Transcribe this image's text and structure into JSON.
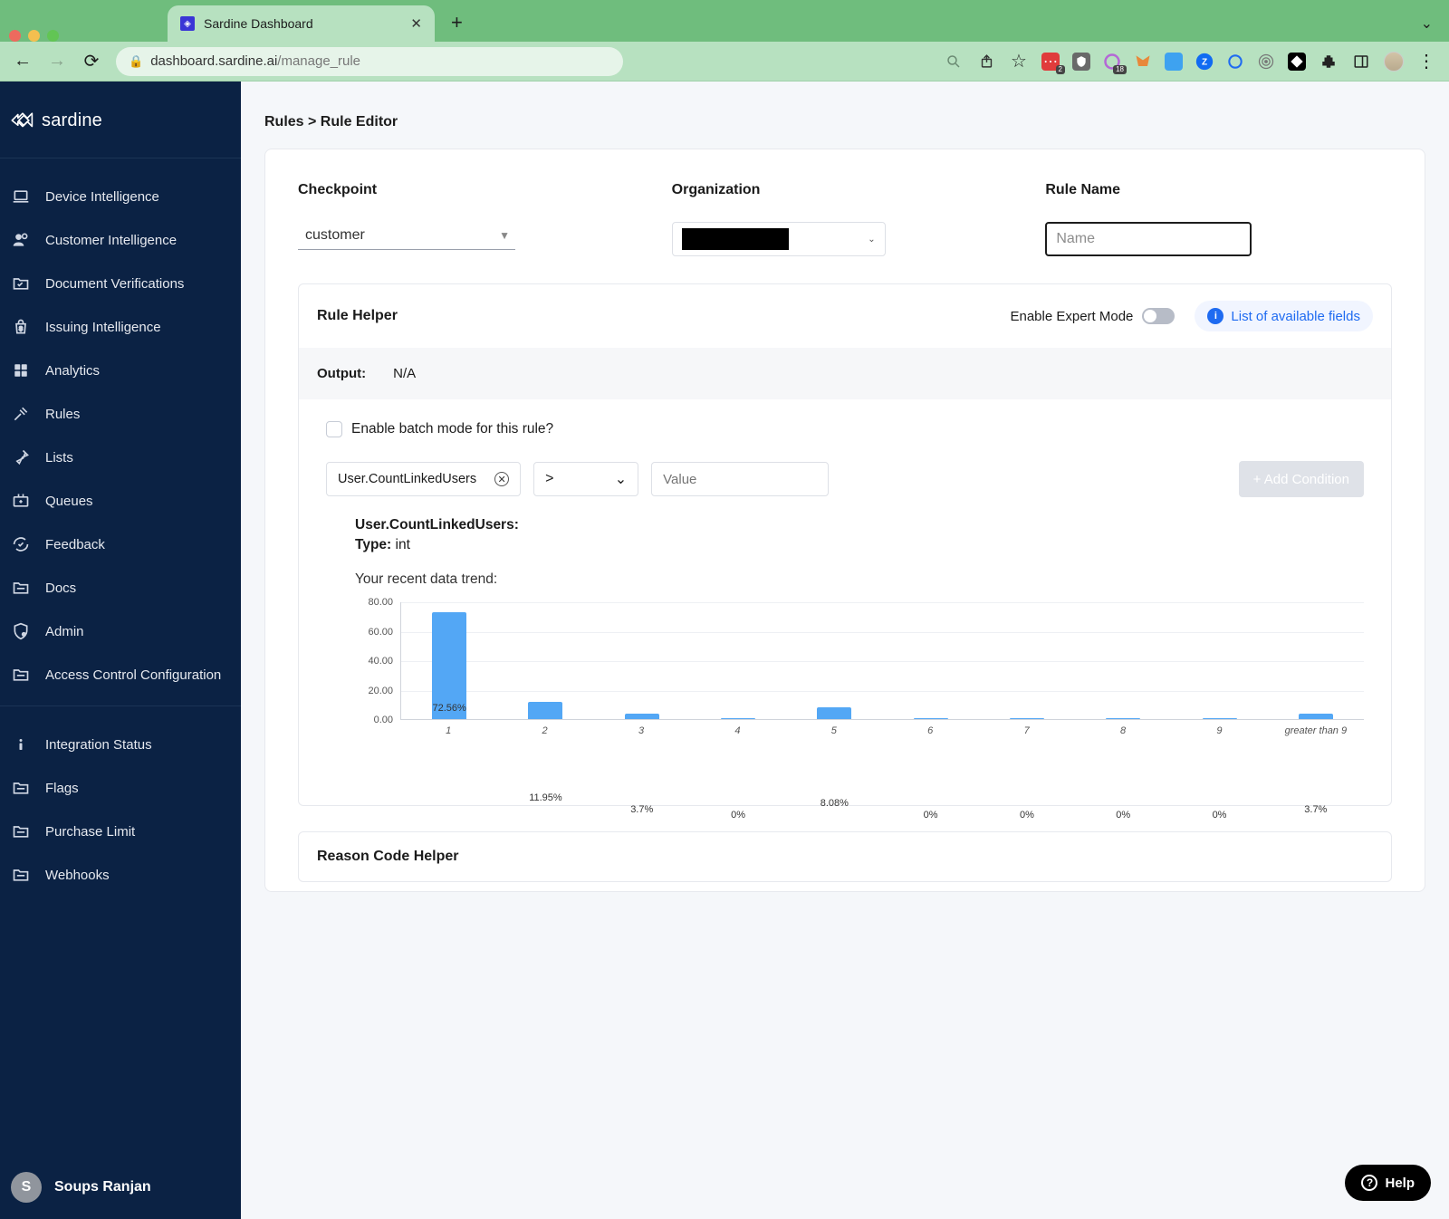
{
  "browser": {
    "tab_title": "Sardine Dashboard",
    "url_host": "dashboard.sardine.ai",
    "url_path": "/manage_rule"
  },
  "brand": "sardine",
  "sidebar": {
    "items": [
      {
        "label": "Device Intelligence"
      },
      {
        "label": "Customer Intelligence"
      },
      {
        "label": "Document Verifications"
      },
      {
        "label": "Issuing Intelligence"
      },
      {
        "label": "Analytics"
      },
      {
        "label": "Rules"
      },
      {
        "label": "Lists"
      },
      {
        "label": "Queues"
      },
      {
        "label": "Feedback"
      },
      {
        "label": "Docs"
      },
      {
        "label": "Admin"
      },
      {
        "label": "Access Control Configuration"
      }
    ],
    "secondary": [
      {
        "label": "Integration Status"
      },
      {
        "label": "Flags"
      },
      {
        "label": "Purchase Limit"
      },
      {
        "label": "Webhooks"
      }
    ]
  },
  "user": {
    "initial": "S",
    "name": "Soups Ranjan"
  },
  "breadcrumb": "Rules > Rule Editor",
  "form": {
    "checkpoint_label": "Checkpoint",
    "checkpoint_value": "customer",
    "organization_label": "Organization",
    "rulename_label": "Rule Name",
    "rulename_placeholder": "Name"
  },
  "helper": {
    "title": "Rule Helper",
    "expert_label": "Enable Expert Mode",
    "fields_link": "List of available fields",
    "output_key": "Output:",
    "output_value": "N/A",
    "batch_label": "Enable batch mode for this rule?",
    "field_value": "User.CountLinkedUsers",
    "op_value": ">",
    "value_placeholder": "Value",
    "add_button": "+ Add Condition",
    "info_line1": "User.CountLinkedUsers:",
    "info_type_key": "Type:",
    "info_type_val": " int",
    "trend_title": "Your recent data trend:"
  },
  "reason_helper": {
    "title": "Reason Code Helper"
  },
  "help_fab": "Help",
  "chart_data": {
    "type": "bar",
    "categories": [
      "1",
      "2",
      "3",
      "4",
      "5",
      "6",
      "7",
      "8",
      "9",
      "greater than 9"
    ],
    "values": [
      72.56,
      11.95,
      3.7,
      0,
      8.08,
      0,
      0,
      0,
      0,
      3.7
    ],
    "value_labels": [
      "72.56%",
      "11.95%",
      "3.7%",
      "0%",
      "8.08%",
      "0%",
      "0%",
      "0%",
      "0%",
      "3.7%"
    ],
    "ylabel": "",
    "yticks": [
      0.0,
      20.0,
      40.0,
      60.0,
      80.0
    ],
    "ylim": [
      0,
      80
    ]
  }
}
